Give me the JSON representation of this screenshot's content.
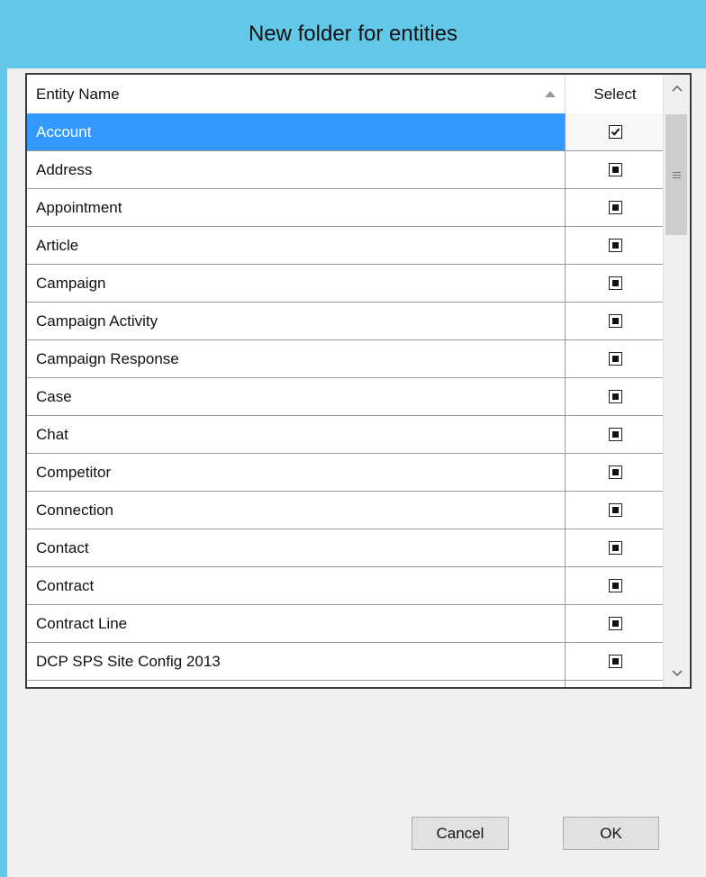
{
  "window": {
    "title": "New folder for entities"
  },
  "grid": {
    "columns": {
      "name": "Entity Name",
      "select": "Select"
    },
    "rows": [
      {
        "name": "Account",
        "state": "checked",
        "selected": true
      },
      {
        "name": "Address",
        "state": "indeterminate",
        "selected": false
      },
      {
        "name": "Appointment",
        "state": "indeterminate",
        "selected": false
      },
      {
        "name": "Article",
        "state": "indeterminate",
        "selected": false
      },
      {
        "name": "Campaign",
        "state": "indeterminate",
        "selected": false
      },
      {
        "name": "Campaign Activity",
        "state": "indeterminate",
        "selected": false
      },
      {
        "name": "Campaign Response",
        "state": "indeterminate",
        "selected": false
      },
      {
        "name": "Case",
        "state": "indeterminate",
        "selected": false
      },
      {
        "name": "Chat",
        "state": "indeterminate",
        "selected": false
      },
      {
        "name": "Competitor",
        "state": "indeterminate",
        "selected": false
      },
      {
        "name": "Connection",
        "state": "indeterminate",
        "selected": false
      },
      {
        "name": "Contact",
        "state": "indeterminate",
        "selected": false
      },
      {
        "name": "Contract",
        "state": "indeterminate",
        "selected": false
      },
      {
        "name": "Contract Line",
        "state": "indeterminate",
        "selected": false
      },
      {
        "name": "DCP SPS Site Config 2013",
        "state": "indeterminate",
        "selected": false
      },
      {
        "name": "",
        "state": "indeterminate",
        "selected": false
      }
    ]
  },
  "buttons": {
    "cancel": "Cancel",
    "ok": "OK"
  },
  "colors": {
    "titlebar": "#62c8e8",
    "selection": "#3399ff"
  }
}
